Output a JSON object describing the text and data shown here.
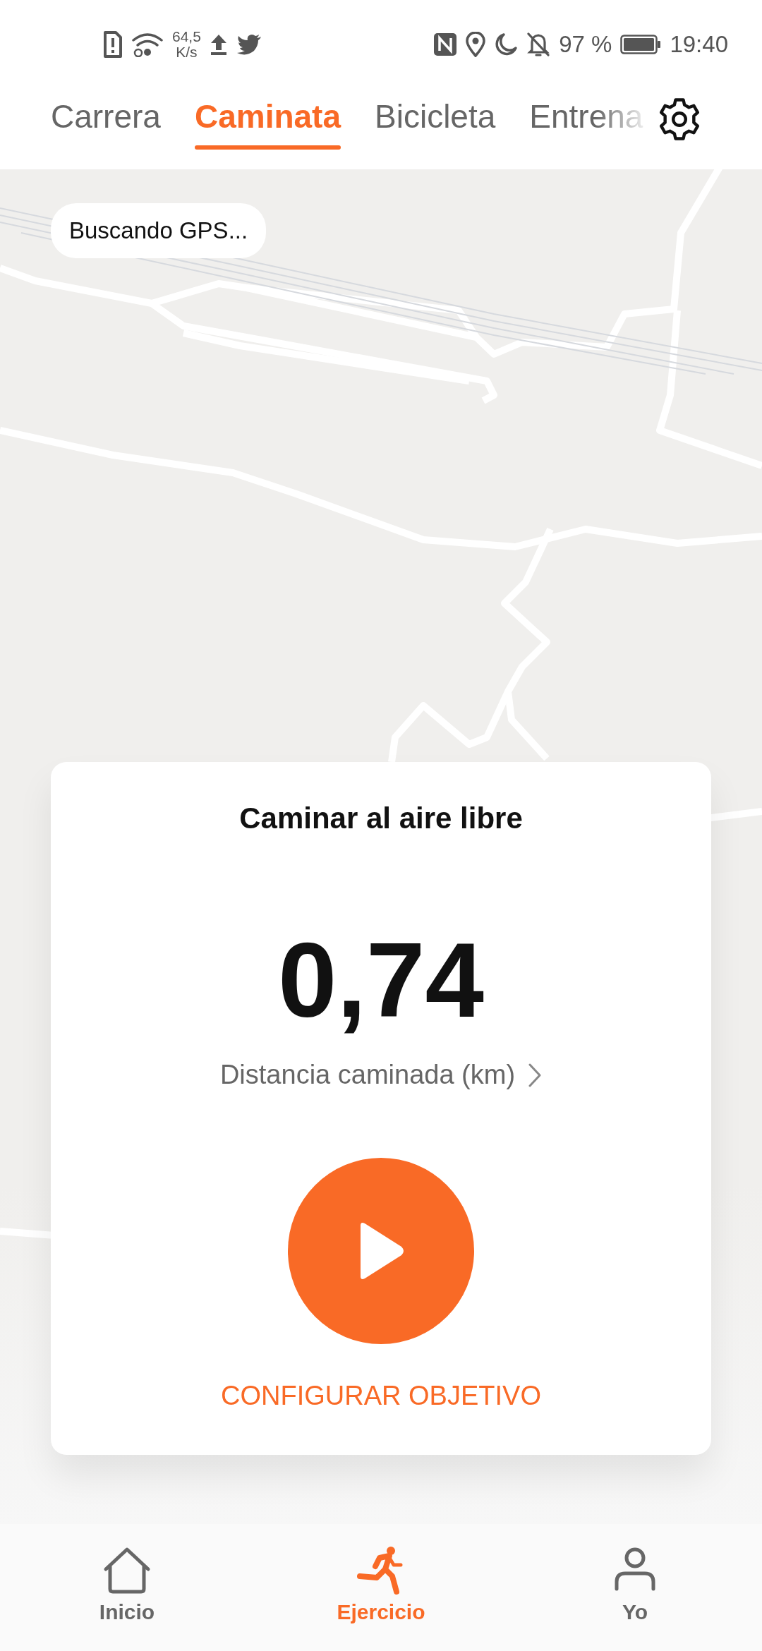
{
  "status_bar": {
    "net_speed": "64,5",
    "net_unit": "K/s",
    "battery": "97 %",
    "time": "19:40"
  },
  "tabs": [
    {
      "label": "Carrera",
      "selected": false
    },
    {
      "label": "Caminata",
      "selected": true
    },
    {
      "label": "Bicicleta",
      "selected": false
    },
    {
      "label": "Entrena",
      "selected": false
    }
  ],
  "map": {
    "kind": "picture",
    "gps_status": "Buscando GPS..."
  },
  "card": {
    "title": "Caminar al aire libre",
    "value": "0,74",
    "metric": "Distancia caminada (km)",
    "action": "CONFIGURAR OBJETIVO"
  },
  "nav": [
    {
      "label": "Inicio",
      "kind": "home",
      "selected": false
    },
    {
      "label": "Ejercicio",
      "kind": "exercise",
      "selected": true
    },
    {
      "label": "Yo",
      "kind": "profile",
      "selected": false
    }
  ]
}
